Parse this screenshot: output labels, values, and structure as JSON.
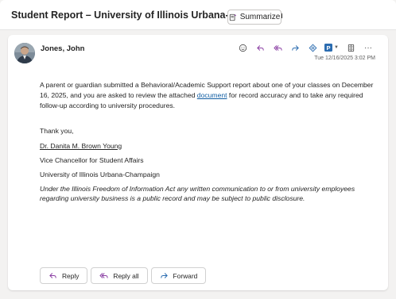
{
  "header": {
    "subject": "Student Report – University of Illinois Urbana-Champaign",
    "summarize_label": "Summarize"
  },
  "message": {
    "sender": "Jones, John",
    "timestamp": "Tue 12/16/2025 3:02 PM",
    "toolbar_icons": [
      "emoji-icon",
      "reply-icon",
      "reply-all-icon",
      "forward-icon",
      "loop-icon",
      "p-addin-icon",
      "immersive-reader-icon",
      "more-icon"
    ],
    "p_badge": "P",
    "more_label": "···",
    "body": {
      "para1_before": "A parent or guardian submitted a Behavioral/Academic Support report about one of your classes on December 16, 2025, and you are asked to review the attached ",
      "para1_link": "document",
      "para1_after": " for record accuracy and to take any required follow-up according to university procedures.",
      "closing": "Thank you,",
      "sig_name": "Dr. Danita M. Brown Young",
      "sig_title": "Vice Chancellor for Student Affairs",
      "sig_org": "University of Illinois Urbana-Champaign",
      "notice": "Under the Illinois Freedom of Information Act any written communication to or from university employees regarding university business is a public record and may be subject to public disclosure."
    }
  },
  "reply_actions": {
    "reply": "Reply",
    "reply_all": "Reply all",
    "forward": "Forward"
  },
  "colors": {
    "accent_purple": "#8a3ea3",
    "link_blue": "#115ea3",
    "addin_blue": "#2b6cb0"
  }
}
